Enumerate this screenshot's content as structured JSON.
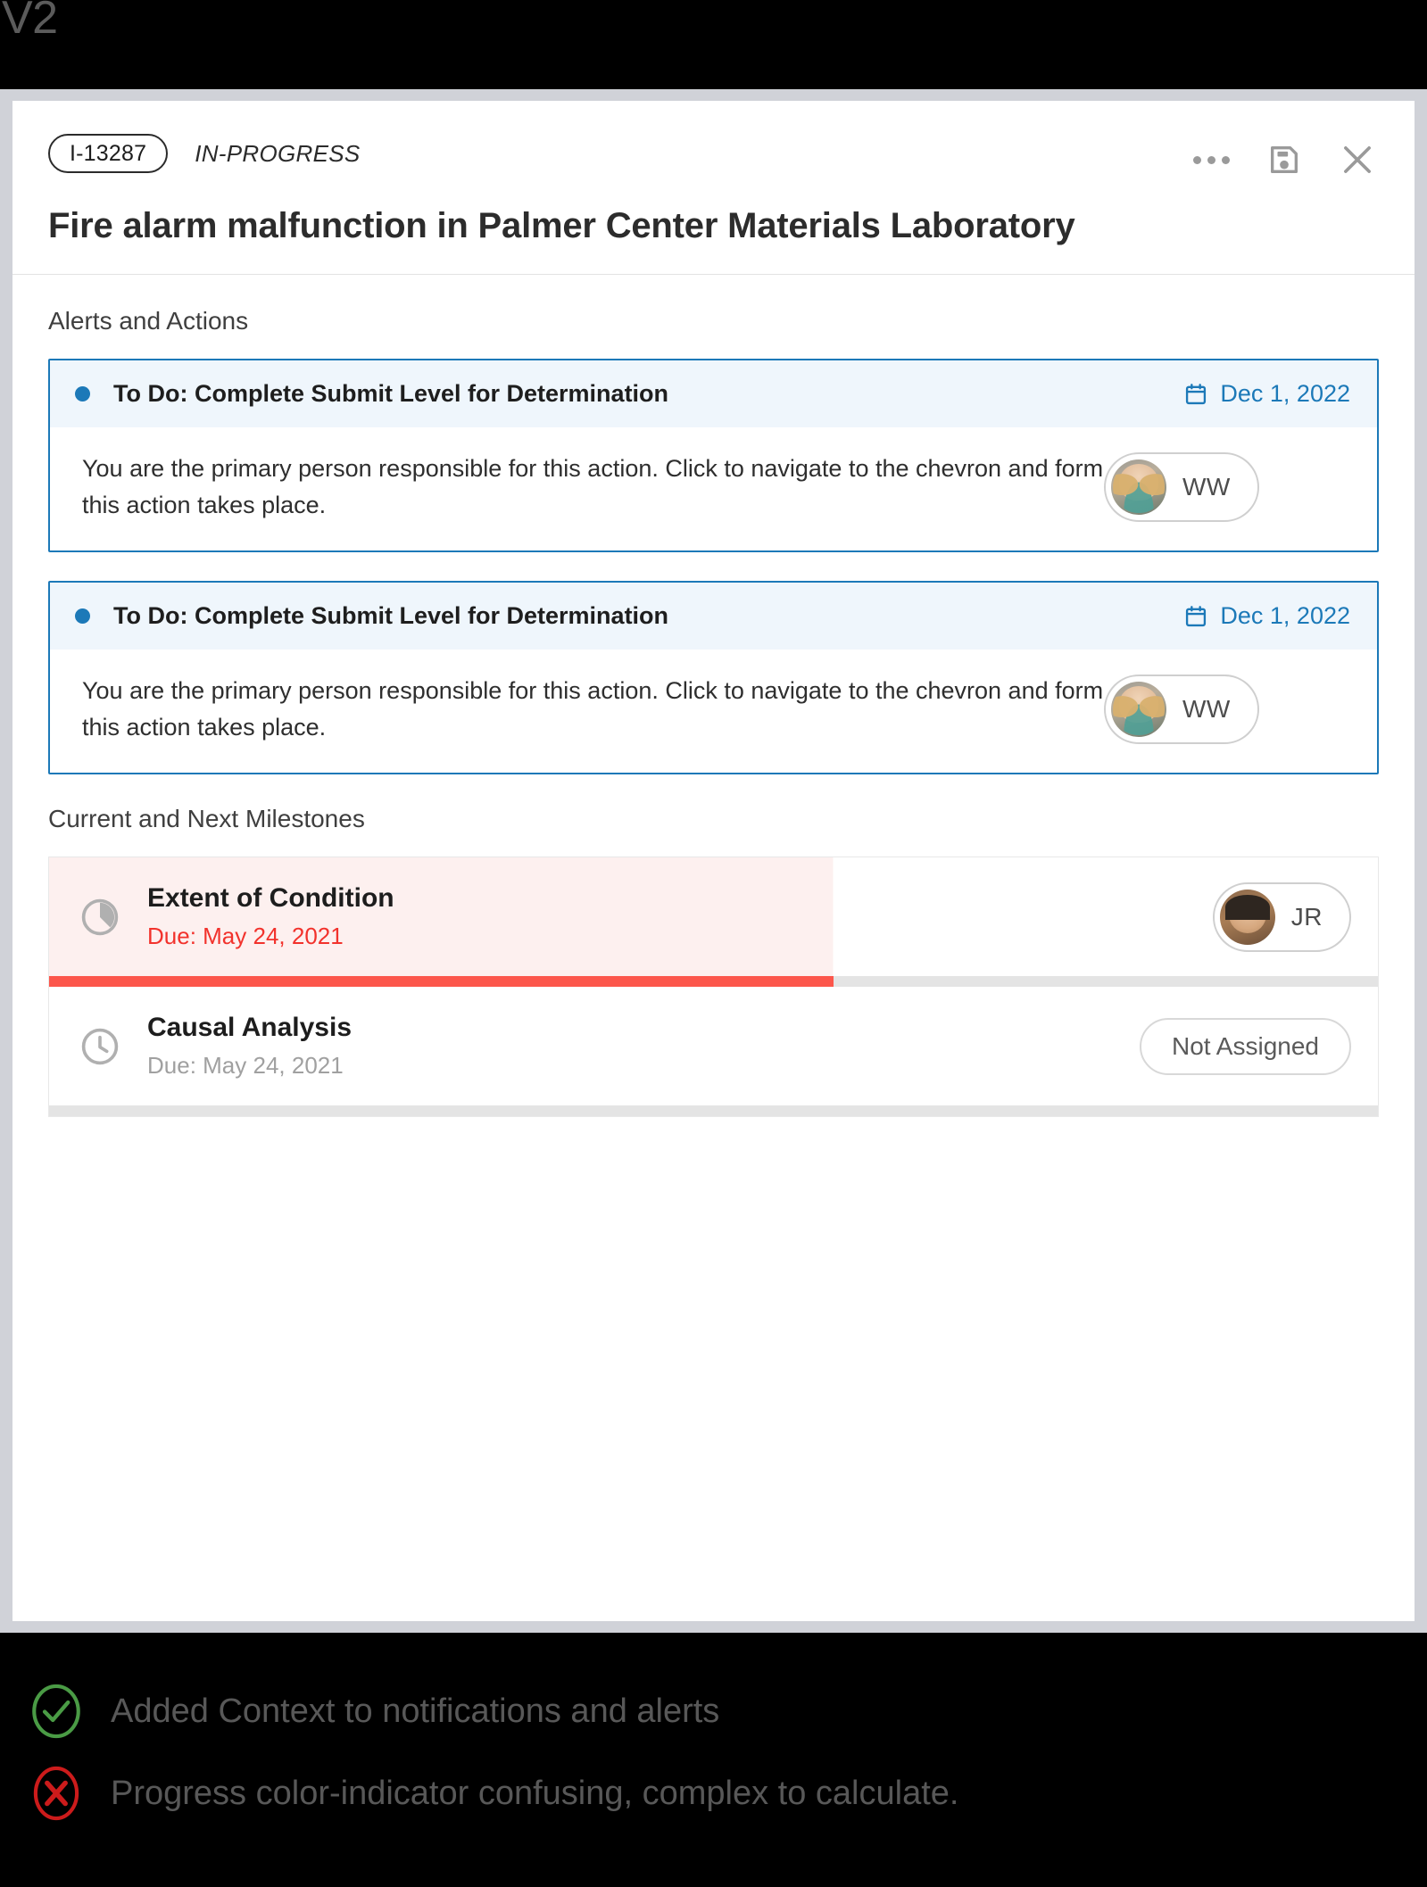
{
  "version_label": "V2",
  "modal": {
    "header": {
      "id_badge": "I-13287",
      "status": "IN-PROGRESS",
      "title": "Fire alarm malfunction in Palmer Center Materials Laboratory",
      "actions": [
        {
          "name": "more-options",
          "label": "•••"
        },
        {
          "name": "save",
          "label": "Save"
        },
        {
          "name": "close",
          "label": "Close"
        }
      ]
    },
    "alerts_section": {
      "heading": "Alerts and Actions",
      "cards": [
        {
          "title": "To Do: Complete Submit Level for Determination",
          "date": "Dec 1, 2022",
          "body": "You are the primary person responsible for this action. Click to navigate to the chevron and form this action takes place.",
          "assignee_initials": "WW"
        },
        {
          "title": "To Do: Complete Submit Level for Determination",
          "date": "Dec 1, 2022",
          "body": "You are the primary person responsible for this action. Click to navigate to the chevron and form this action takes place.",
          "assignee_initials": "WW"
        }
      ]
    },
    "milestones_section": {
      "heading": "Current and Next Milestones",
      "rows": [
        {
          "name": "Extent of Condition",
          "due": "Due: May 24, 2021",
          "status": "overdue",
          "icon": "pie-progress-icon",
          "progress_percent": 59,
          "assignee_initials": "JR"
        },
        {
          "name": "Causal Analysis",
          "due": "Due: May 24, 2021",
          "status": "pending",
          "icon": "clock-icon",
          "progress_percent": 0,
          "assignee_label": "Not Assigned"
        }
      ]
    }
  },
  "annotations": [
    {
      "type": "positive",
      "icon": "check-circle-icon",
      "text": "Added Context to notifications and alerts",
      "color": "#4a9b45"
    },
    {
      "type": "negative",
      "icon": "x-circle-icon",
      "text": "Progress color-indicator confusing, complex to calculate.",
      "color": "#cc1b1b"
    }
  ],
  "colors": {
    "accent_blue": "#1c79b8",
    "alert_bg": "#eff6fc",
    "overdue_red": "#f2322c",
    "progress_red": "#fc564b",
    "gutter": "#d0d2d8"
  }
}
